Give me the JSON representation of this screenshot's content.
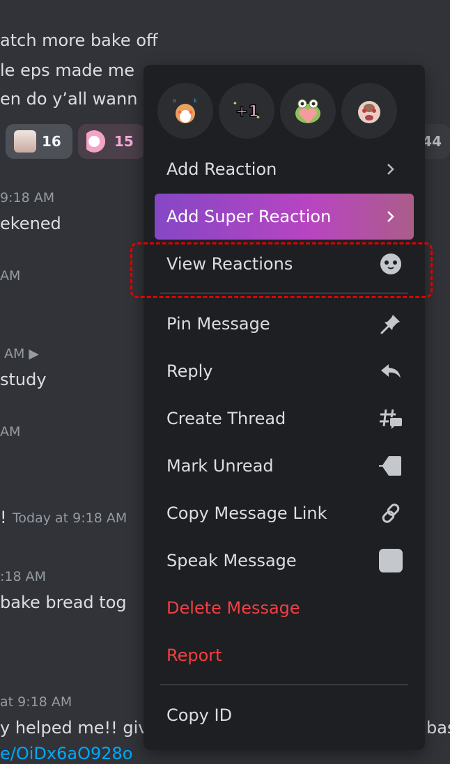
{
  "chat": {
    "lines": [
      {
        "text": "atch more bake off",
        "kind": "message"
      },
      {
        "text": "le eps made me",
        "kind": "message"
      },
      {
        "text": "en do y’all wann",
        "kind": "message"
      },
      {
        "text": "9:18 AM",
        "kind": "timestamp"
      },
      {
        "text": "ekened",
        "kind": "message"
      },
      {
        "text": "AM",
        "kind": "timestamp"
      },
      {
        "text": "AM ▶",
        "kind": "timestamp"
      },
      {
        "text": "study",
        "kind": "message"
      },
      {
        "text": "AM",
        "kind": "timestamp"
      },
      {
        "text": "!",
        "kind": "message"
      },
      {
        "text": "Today at 9:18 AM",
        "kind": "timestamp"
      },
      {
        "text": ":18 AM",
        "kind": "timestamp"
      },
      {
        "text": " bake bread tog",
        "kind": "message"
      },
      {
        "text": "at 9:18 AM",
        "kind": "timestamp"
      },
      {
        "text": "y helped me!! giv",
        "kind": "message"
      },
      {
        "text": "bas",
        "kind": "message"
      },
      {
        "text": "e/OiDx6aO928o",
        "kind": "link"
      }
    ],
    "reactions": [
      {
        "emoji": "girl-sticker",
        "count": "16"
      },
      {
        "emoji": "ghost-hug-sticker",
        "count": "15"
      },
      {
        "emoji": "hidden",
        "count": "44"
      }
    ]
  },
  "menu": {
    "quick_reactions": [
      "ok-shiba-sticker",
      "plus-one-sticker",
      "frog-heart-sticker",
      "angry-ferret-sticker"
    ],
    "items": [
      {
        "label": "Add Reaction",
        "icon": "chevron-right-icon"
      },
      {
        "label": "Add Super Reaction",
        "icon": "chevron-right-icon"
      },
      {
        "label": "View Reactions",
        "icon": "smiley-icon"
      },
      {
        "label": "Pin Message",
        "icon": "pin-icon"
      },
      {
        "label": "Reply",
        "icon": "reply-icon"
      },
      {
        "label": "Create Thread",
        "icon": "thread-icon"
      },
      {
        "label": "Mark Unread",
        "icon": "mark-unread-icon"
      },
      {
        "label": "Copy Message Link",
        "icon": "link-icon"
      },
      {
        "label": "Speak Message",
        "icon": "speak-checkbox-icon"
      },
      {
        "label": "Delete Message",
        "icon": ""
      },
      {
        "label": "Report",
        "icon": ""
      },
      {
        "label": "Copy ID",
        "icon": ""
      }
    ],
    "colors": {
      "danger": "#f23f43",
      "super_start": "#8547c6",
      "super_end": "#ab5d8a",
      "highlight": "#e00000"
    }
  }
}
